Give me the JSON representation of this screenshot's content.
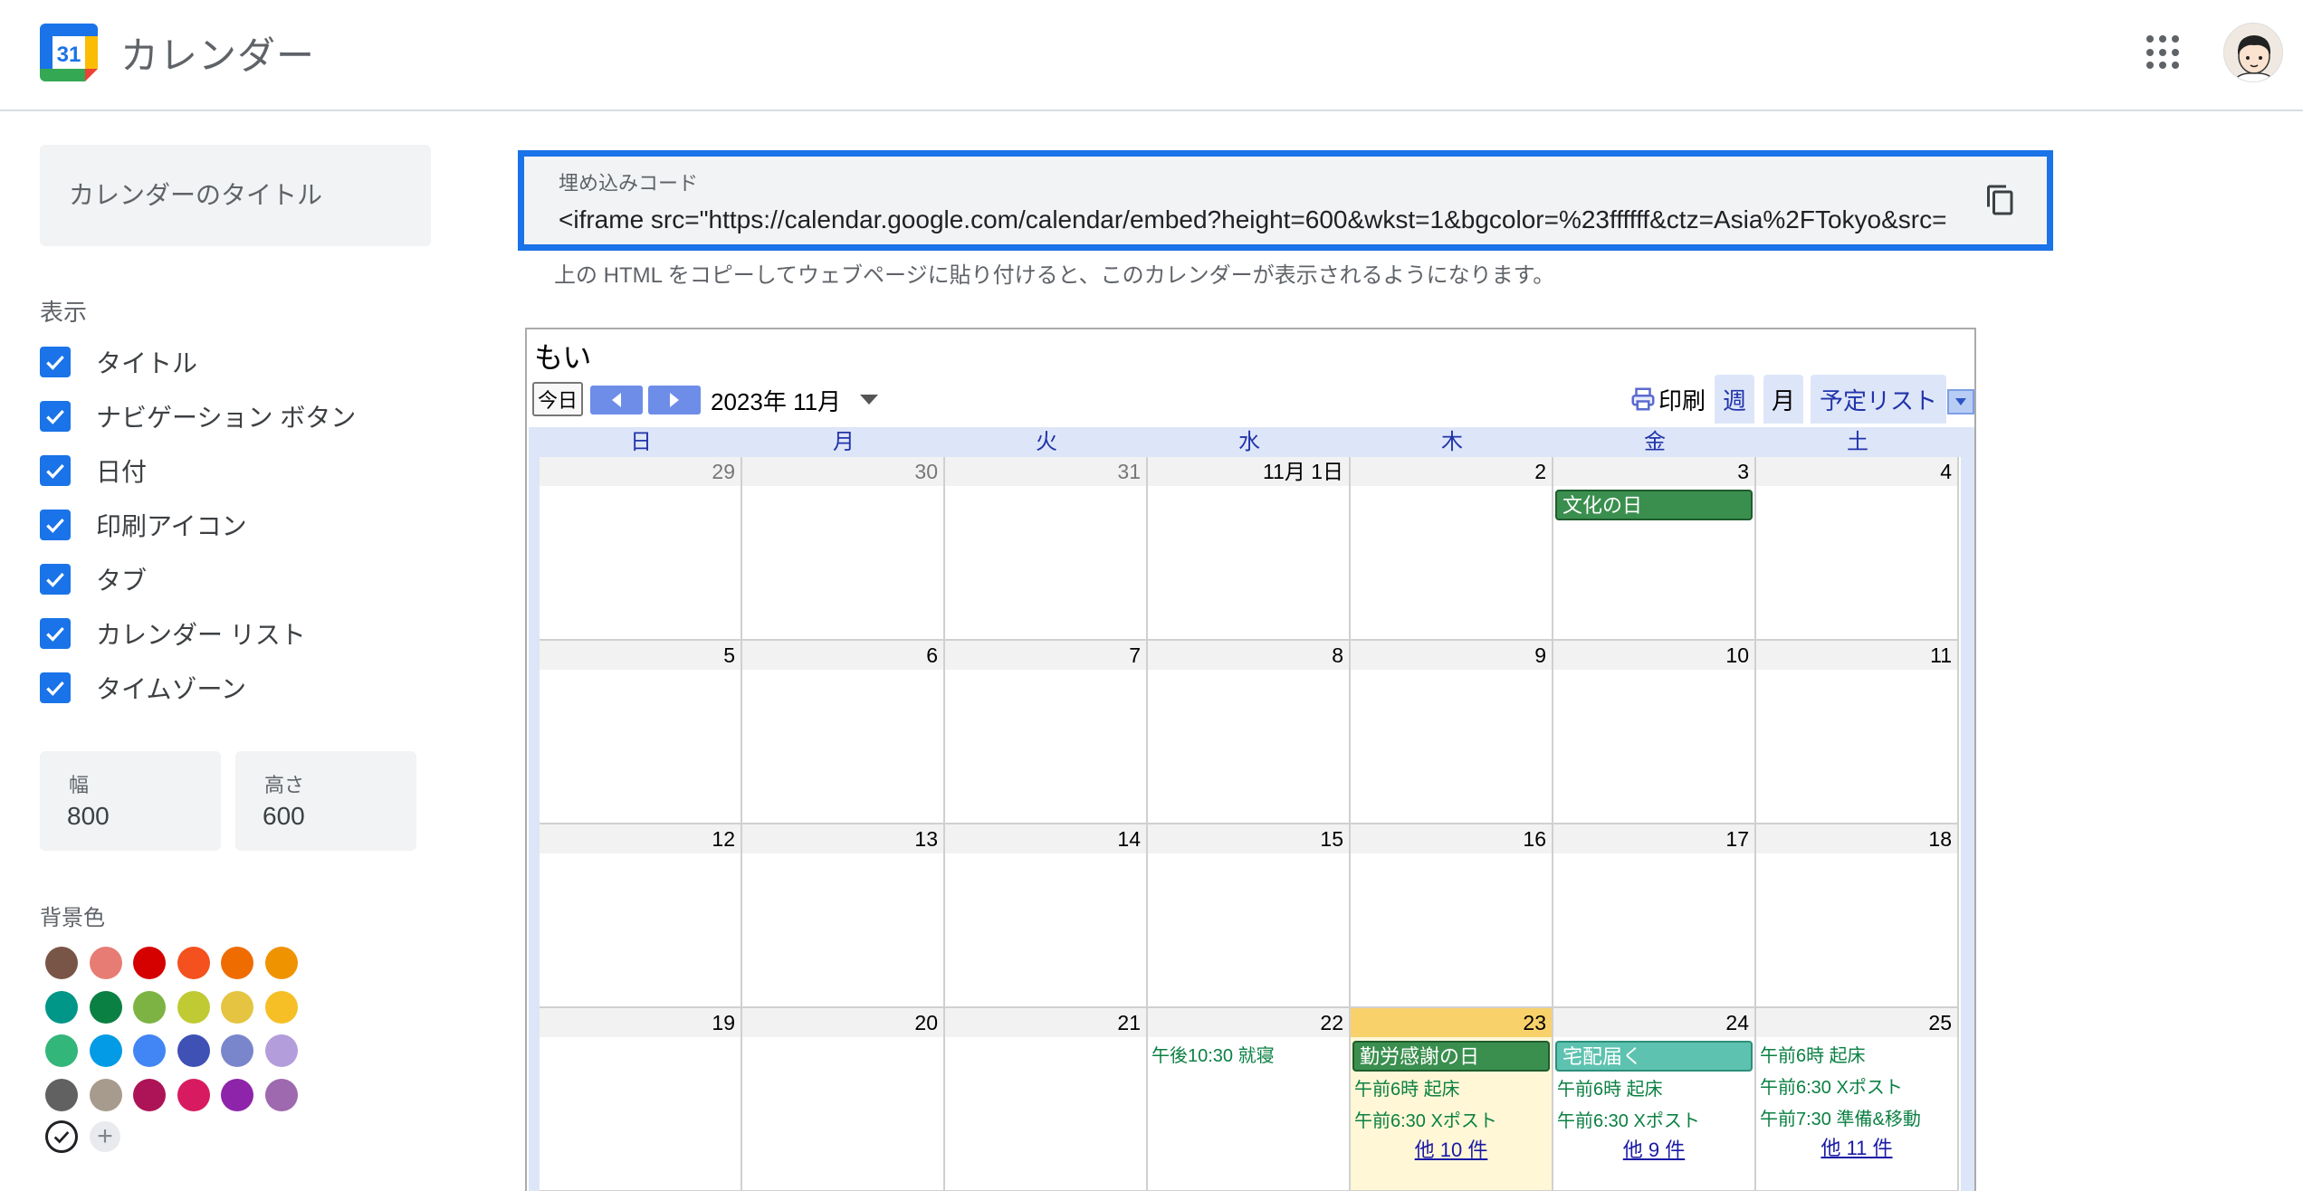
{
  "header": {
    "app_title": "カレンダー",
    "logo_day": "31"
  },
  "sidebar": {
    "title_placeholder": "カレンダーのタイトル",
    "display_label": "表示",
    "options": [
      {
        "label": "タイトル",
        "checked": true
      },
      {
        "label": "ナビゲーション ボタン",
        "checked": true
      },
      {
        "label": "日付",
        "checked": true
      },
      {
        "label": "印刷アイコン",
        "checked": true
      },
      {
        "label": "タブ",
        "checked": true
      },
      {
        "label": "カレンダー リスト",
        "checked": true
      },
      {
        "label": "タイムゾーン",
        "checked": true
      }
    ],
    "width_label": "幅",
    "width_value": "800",
    "height_label": "高さ",
    "height_value": "600",
    "bg_label": "背景色",
    "bg_colors": [
      [
        "#795548",
        "#e67c73",
        "#d50000",
        "#f4511e",
        "#ef6c00",
        "#f09300"
      ],
      [
        "#009688",
        "#0b8043",
        "#7cb342",
        "#c0ca33",
        "#e4c441",
        "#f6bf26"
      ],
      [
        "#33b679",
        "#039be5",
        "#4285f4",
        "#3f51b5",
        "#7986cb",
        "#b39ddb"
      ],
      [
        "#616161",
        "#a79b8e",
        "#ad1457",
        "#d81b60",
        "#8e24aa",
        "#9e69af"
      ]
    ]
  },
  "embed": {
    "label": "埋め込みコード",
    "code": "<iframe src=\"https://calendar.google.com/calendar/embed?height=600&wkst=1&bgcolor=%23ffffff&ctz=Asia%2FTokyo&src=",
    "hint": "上の HTML をコピーしてウェブページに貼り付けると、このカレンダーが表示されるようになります。"
  },
  "calendar": {
    "title": "もい",
    "today_label": "今日",
    "month_label": "2023年 11月",
    "print_label": "印刷",
    "tabs": [
      "週",
      "月",
      "予定リスト"
    ],
    "weekdays": [
      "日",
      "月",
      "火",
      "水",
      "木",
      "金",
      "土"
    ],
    "weeks": [
      [
        {
          "day": "29",
          "other": true
        },
        {
          "day": "30",
          "other": true
        },
        {
          "day": "31",
          "other": true
        },
        {
          "day": "11月 1日"
        },
        {
          "day": "2"
        },
        {
          "day": "3",
          "bars": [
            {
              "text": "文化の日",
              "color": "#3a8f4e"
            }
          ]
        },
        {
          "day": "4"
        }
      ],
      [
        {
          "day": "5"
        },
        {
          "day": "6"
        },
        {
          "day": "7"
        },
        {
          "day": "8"
        },
        {
          "day": "9"
        },
        {
          "day": "10"
        },
        {
          "day": "11"
        }
      ],
      [
        {
          "day": "12"
        },
        {
          "day": "13"
        },
        {
          "day": "14"
        },
        {
          "day": "15"
        },
        {
          "day": "16"
        },
        {
          "day": "17"
        },
        {
          "day": "18"
        }
      ],
      [
        {
          "day": "19"
        },
        {
          "day": "20"
        },
        {
          "day": "21"
        },
        {
          "day": "22",
          "events": [
            "午後10:30 就寝"
          ]
        },
        {
          "day": "23",
          "today": true,
          "bars": [
            {
              "text": "勤労感謝の日",
              "color": "#3a8f4e"
            }
          ],
          "events": [
            "午前6時 起床",
            "午前6:30 Xポスト"
          ],
          "more": "他 10 件"
        },
        {
          "day": "24",
          "bars": [
            {
              "text": "宅配届く",
              "color": "#5ec2b0"
            }
          ],
          "events": [
            "午前6時 起床",
            "午前6:30 Xポスト"
          ],
          "more": "他 9 件"
        },
        {
          "day": "25",
          "events": [
            "午前6時 起床",
            "午前6:30 Xポスト",
            "午前7:30 準備&移動"
          ],
          "more": "他 11 件"
        }
      ]
    ]
  }
}
